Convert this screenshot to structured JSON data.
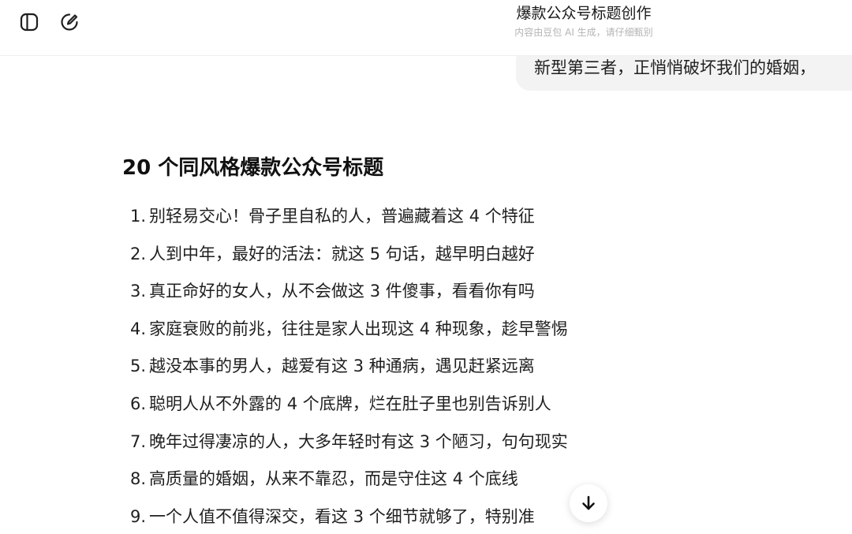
{
  "header": {
    "title": "爆款公众号标题创作",
    "ai_note": "内容由豆包 AI 生成，请仔细甄别",
    "icons": [
      "sidebar-toggle-icon",
      "new-chat-icon"
    ]
  },
  "user_message": {
    "text": "新型第三者，正悄悄破坏我们的婚姻，"
  },
  "answer": {
    "heading": "20 个同风格爆款公众号标题",
    "items": [
      {
        "num": "1.",
        "text": "别轻易交心！骨子里自私的人，普遍藏着这 4 个特征"
      },
      {
        "num": "2.",
        "text": "人到中年，最好的活法：就这 5 句话，越早明白越好"
      },
      {
        "num": "3.",
        "text": "真正命好的女人，从不会做这 3 件傻事，看看你有吗"
      },
      {
        "num": "4.",
        "text": "家庭衰败的前兆，往往是家人出现这 4 种现象，趁早警惕"
      },
      {
        "num": "5.",
        "text": "越没本事的男人，越爱有这 3 种通病，遇见赶紧远离"
      },
      {
        "num": "6.",
        "text": "聪明人从不外露的 4 个底牌，烂在肚子里也别告诉别人"
      },
      {
        "num": "7.",
        "text": "晚年过得凄凉的人，大多年轻时有这 3 个陋习，句句现实"
      },
      {
        "num": "8.",
        "text": "高质量的婚姻，从来不靠忍，而是守住这 4 个底线"
      },
      {
        "num": "9.",
        "text": "一个人值不值得深交，看这 3 个细节就够了，特别准"
      }
    ]
  },
  "scroll_button": {
    "icon": "arrow-down-icon"
  }
}
